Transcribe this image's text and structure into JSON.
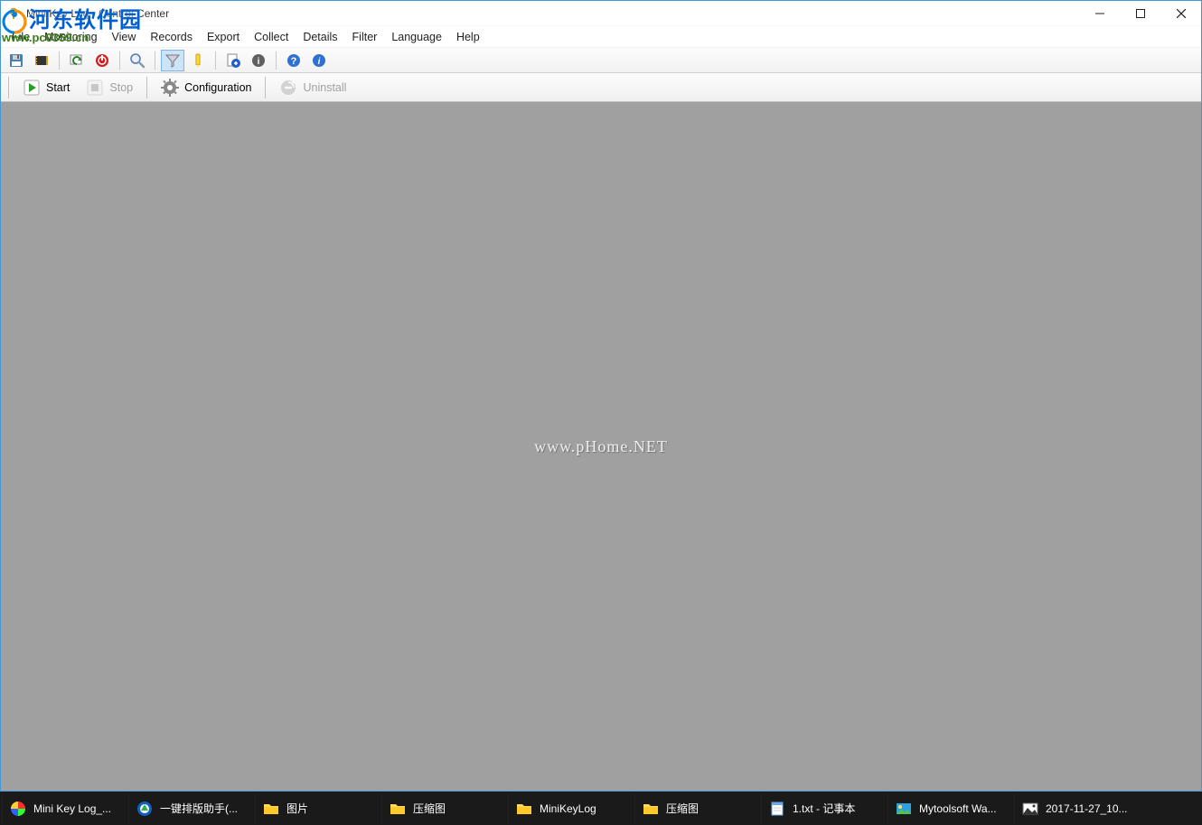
{
  "window": {
    "title": "Mini Key Log - Control Center"
  },
  "menu": {
    "items": [
      "File",
      "Monitoring",
      "View",
      "Records",
      "Export",
      "Collect",
      "Details",
      "Filter",
      "Language",
      "Help"
    ]
  },
  "toolbar1": {
    "icons": [
      "save-icon",
      "film-icon",
      "refresh-icon",
      "power-icon",
      "zoom-icon",
      "funnel-icon",
      "highlighter-icon",
      "document-arrow-icon",
      "details-icon",
      "help-icon",
      "about-icon"
    ]
  },
  "toolbar2": {
    "start": "Start",
    "stop": "Stop",
    "configuration": "Configuration",
    "uninstall": "Uninstall"
  },
  "content": {
    "watermark": "www.pHome.NET"
  },
  "overlay": {
    "brand": "河东软件园",
    "url": "www.pc0359.cn"
  },
  "taskbar": {
    "items": [
      {
        "icon": "color-circle-icon",
        "label": "Mini Key Log_..."
      },
      {
        "icon": "browser-icon",
        "label": "一键排版助手(..."
      },
      {
        "icon": "folder-icon",
        "label": "图片"
      },
      {
        "icon": "folder-icon",
        "label": "压缩图"
      },
      {
        "icon": "folder-icon",
        "label": "MiniKeyLog"
      },
      {
        "icon": "folder-icon",
        "label": "压缩图"
      },
      {
        "icon": "notepad-icon",
        "label": "1.txt - 记事本"
      },
      {
        "icon": "image-app-icon",
        "label": "Mytoolsoft Wa..."
      },
      {
        "icon": "photo-icon",
        "label": "2017-11-27_10..."
      }
    ]
  }
}
